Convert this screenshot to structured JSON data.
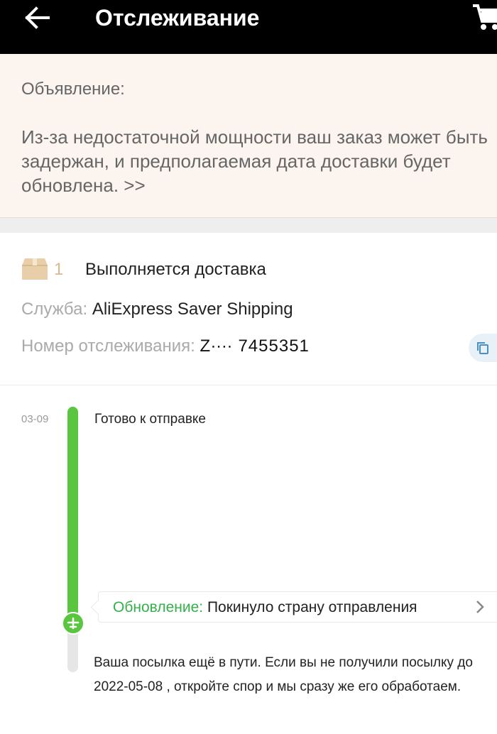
{
  "header": {
    "title": "Отслеживание",
    "back_icon": "arrow-left-icon",
    "cart_icon": "cart-icon"
  },
  "notice": {
    "heading": "Объявление:",
    "text": "Из-за недостаточной мощности ваш заказ может быть задержан, и предполагаемая дата доставки будет обновлена. >>",
    "background": "#fcf4ef"
  },
  "shipment": {
    "package_icon": "package-box-icon",
    "package_count": "1",
    "status": "Выполняется доставка",
    "service_label": "Служба:",
    "service_value": "AliExpress Saver Shipping",
    "tracking_label": "Номер отслеживания:",
    "tracking_number": "Z∙∙∙∙ 7455351",
    "copy_icon": "copy-icon"
  },
  "timeline": {
    "date": "03-09",
    "event_title": "Готово к отправке",
    "accent": "#5ac53f",
    "update_label": "Обновление:",
    "update_value": "Покинуло страну отправления",
    "info_line_1": "Ваша посылка ещё в пути. Если вы не получили посылку до",
    "info_line_2": "2022-05-08 , откройте спор и мы сразу же его обработаем."
  }
}
